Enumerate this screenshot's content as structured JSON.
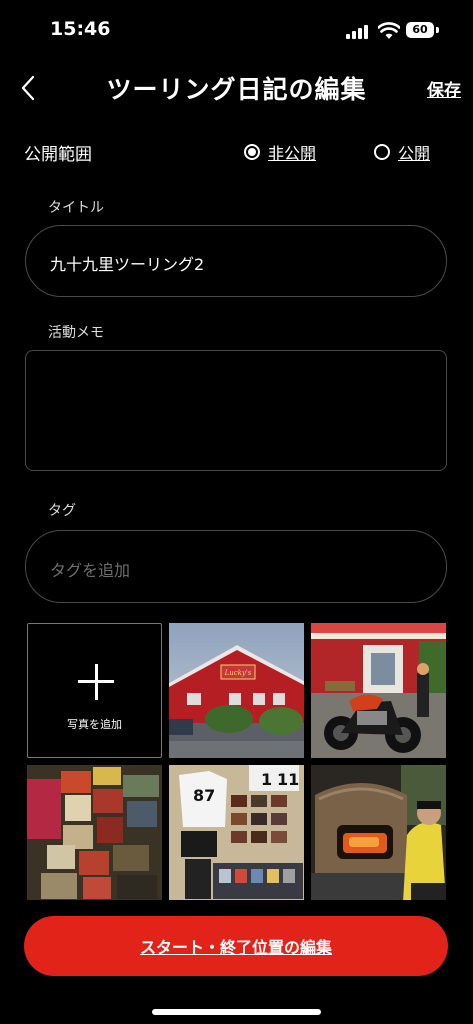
{
  "status_bar": {
    "time": "15:46",
    "battery": "60"
  },
  "header": {
    "title": "ツーリング日記の編集",
    "save_label": "保存"
  },
  "visibility": {
    "label": "公開範囲",
    "options": [
      "非公開",
      "公開"
    ],
    "selected": "非公開"
  },
  "title_field": {
    "label": "タイトル",
    "value": "九十九里ツーリング2"
  },
  "memo_field": {
    "label": "活動メモ",
    "value": ""
  },
  "tag_field": {
    "label": "タグ",
    "placeholder": "タグを追加"
  },
  "photos": {
    "add_label": "写真を追加",
    "items": [
      {
        "name": "red-building-photo",
        "sign_text": "Lucky's"
      },
      {
        "name": "motorcycle-photo"
      },
      {
        "name": "model-kits-photo"
      },
      {
        "name": "jersey-wall-photo",
        "numbers": [
          "1",
          "11",
          "87"
        ]
      },
      {
        "name": "pizza-oven-photo"
      }
    ]
  },
  "bottom_button": {
    "label": "スタート・終了位置の編集"
  },
  "colors": {
    "background": "#000000",
    "accent": "#e2231a",
    "border": "#4a4a4a",
    "placeholder": "#6e6e6e"
  }
}
